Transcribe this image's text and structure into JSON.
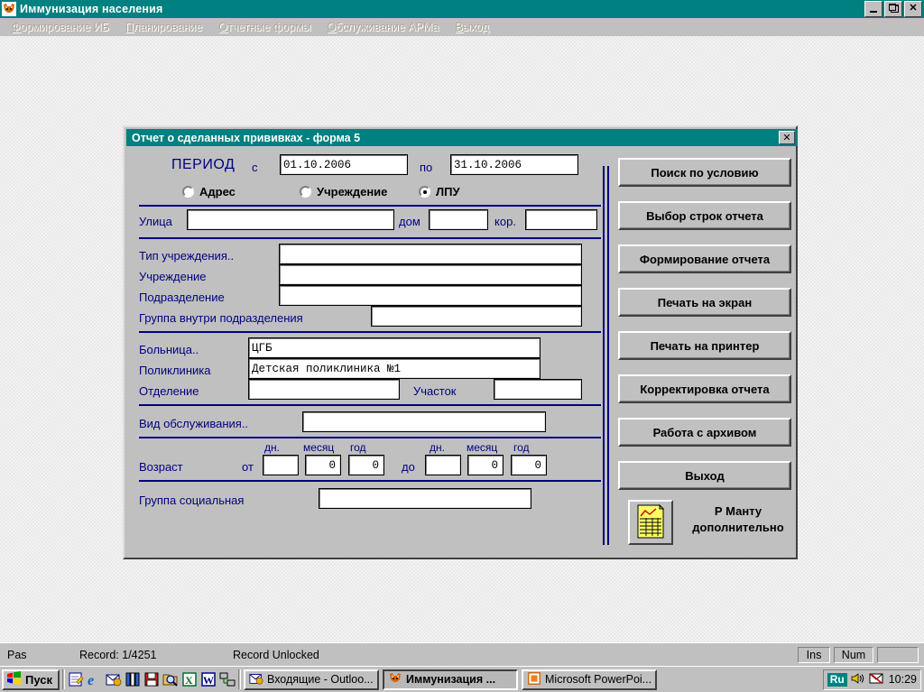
{
  "app": {
    "title": "Иммунизация населения",
    "icon": "fox-icon",
    "window_buttons": [
      {
        "name": "minimize-button",
        "glyph": "_"
      },
      {
        "name": "restore-button",
        "glyph": "❐"
      },
      {
        "name": "close-button",
        "glyph": "✕"
      }
    ],
    "menu": [
      {
        "label": "Формирование ИБ",
        "accel": "Ф"
      },
      {
        "label": "Планирование",
        "accel": "П"
      },
      {
        "label": "Отчетные формы",
        "accel": "О"
      },
      {
        "label": "Обслуживание АРМа",
        "accel": "О"
      },
      {
        "label": "Выход",
        "accel": "В"
      }
    ]
  },
  "dialog": {
    "title": "Отчет о сделанных прививках - форма 5",
    "close_glyph": "✕",
    "period": {
      "label": "ПЕРИОД",
      "from_label": "с",
      "from_value": "01.10.2006",
      "to_label": "по",
      "to_value": "31.10.2006"
    },
    "mode_radios": [
      {
        "label": "Адрес",
        "checked": false
      },
      {
        "label": "Учреждение",
        "checked": false
      },
      {
        "label": "ЛПУ",
        "checked": true
      }
    ],
    "address": {
      "street_label": "Улица",
      "street_value": "",
      "house_label": "дом",
      "house_value": "",
      "building_label": "кор.",
      "building_value": ""
    },
    "institution": {
      "type_label": "Тип учреждения..",
      "type_value": "",
      "inst_label": "Учреждение",
      "inst_value": "",
      "division_label": "Подразделение",
      "division_value": "",
      "group_label": "Группа внутри подразделения",
      "group_value": ""
    },
    "lpu": {
      "hospital_label": "Больница..",
      "hospital_value": "ЦГБ",
      "polyclinic_label": "Поликлиника",
      "polyclinic_value": "Детская поликлиника №1",
      "department_label": "Отделение",
      "department_value": "",
      "uchastok_label": "Участок",
      "uchastok_value": ""
    },
    "service": {
      "label": "Вид обслуживания..",
      "value": ""
    },
    "age": {
      "label": "Возраст",
      "from_label": "от",
      "to_label": "до",
      "unit_days": "дн.",
      "unit_month": "месяц",
      "unit_year": "год",
      "from_days": "",
      "from_month": "0",
      "from_year": "0",
      "to_days": "",
      "to_month": "0",
      "to_year": "0"
    },
    "social": {
      "label": "Группа социальная",
      "value": ""
    },
    "buttons": [
      {
        "label": "Поиск по условию",
        "name": "search-by-condition-button"
      },
      {
        "label": "Выбор строк отчета",
        "name": "select-report-rows-button"
      },
      {
        "label": "Формирование отчета",
        "name": "generate-report-button"
      },
      {
        "label": "Печать на экран",
        "name": "print-to-screen-button"
      },
      {
        "label": "Печать на принтер",
        "name": "print-to-printer-button"
      },
      {
        "label": "Корректировка отчета",
        "name": "correct-report-button"
      },
      {
        "label": "Работа с архивом",
        "name": "work-with-archive-button"
      },
      {
        "label": "Выход",
        "name": "exit-button"
      }
    ],
    "mantu": {
      "icon": "report-sheet-icon",
      "line1": "Р Манту",
      "line2": "дополнительно"
    }
  },
  "statusbar": {
    "mode": "Pas",
    "record": "Record: 1/4251",
    "lock": "Record Unlocked",
    "ins": "Ins",
    "num": "Num",
    "extra": ""
  },
  "taskbar": {
    "start_label": "Пуск",
    "quick_launch": [
      {
        "name": "notepad-icon"
      },
      {
        "name": "internet-explorer-icon"
      },
      {
        "name": "outlook-icon"
      },
      {
        "name": "books-icon"
      },
      {
        "name": "save-disk-icon"
      },
      {
        "name": "find-folder-icon"
      },
      {
        "name": "excel-icon"
      },
      {
        "name": "word-icon"
      },
      {
        "name": "network-icon"
      }
    ],
    "tasks": [
      {
        "label": "Входящие - Outloo...",
        "icon": "outlook-icon",
        "active": false
      },
      {
        "label": "Иммунизация ...",
        "icon": "fox-icon",
        "active": true
      },
      {
        "label": "Microsoft PowerPoi...",
        "icon": "powerpoint-icon",
        "active": false
      }
    ],
    "tray": {
      "language": "Ru",
      "volume_icon": "speaker-icon",
      "mail_icon": "mail-icon",
      "clock": "10:29"
    }
  },
  "colors": {
    "titlebar": "#008080",
    "face": "#c0c0c0",
    "label_blue": "#000080",
    "desktop": "#f3f3f3"
  }
}
